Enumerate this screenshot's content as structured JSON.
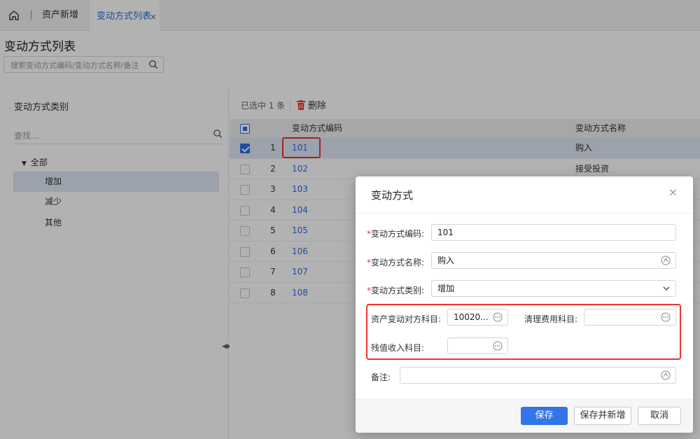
{
  "tabs": {
    "home_icon": "home-icon",
    "items": [
      {
        "label": "资产新增"
      },
      {
        "label": "变动方式列表",
        "close": "×"
      }
    ]
  },
  "page": {
    "title": "变动方式列表",
    "search_placeholder": "搜索变动方式编码/变动方式名称/备注"
  },
  "left_panel": {
    "title": "变动方式类别",
    "find_placeholder": "查找...",
    "tree_root": "全部",
    "tree_items": [
      "增加",
      "减少",
      "其他"
    ],
    "selected_item": "增加"
  },
  "toolbar": {
    "selected_count": "已选中 1 条",
    "delete_label": "删除"
  },
  "grid": {
    "columns": [
      "变动方式编码",
      "变动方式名称"
    ],
    "rows": [
      {
        "num": "1",
        "code": "101",
        "name": "购入",
        "checked": true
      },
      {
        "num": "2",
        "code": "102",
        "name": "接受投资",
        "checked": false
      },
      {
        "num": "3",
        "code": "103",
        "name": "",
        "checked": false
      },
      {
        "num": "4",
        "code": "104",
        "name": "",
        "checked": false
      },
      {
        "num": "5",
        "code": "105",
        "name": "",
        "checked": false
      },
      {
        "num": "6",
        "code": "106",
        "name": "",
        "checked": false
      },
      {
        "num": "7",
        "code": "107",
        "name": "",
        "checked": false
      },
      {
        "num": "8",
        "code": "108",
        "name": "",
        "checked": false
      }
    ]
  },
  "dialog": {
    "title": "变动方式",
    "close": "×",
    "fields": {
      "code_label": "变动方式编码:",
      "code_value": "101",
      "name_label": "变动方式名称:",
      "name_value": "购入",
      "type_label": "变动方式类别:",
      "type_value": "增加",
      "counter_label": "资产变动对方科目:",
      "counter_value": "10020...",
      "clean_label": "清理费用科目:",
      "clean_value": "",
      "residual_label": "残值收入科目:",
      "residual_value": "",
      "remark_label": "备注:",
      "remark_value": ""
    },
    "required_mark": "*",
    "buttons": {
      "save": "保存",
      "save_new": "保存并新增",
      "cancel": "取消"
    }
  },
  "colors": {
    "accent": "#3375e6",
    "link": "#2f6fe0",
    "highlight_box": "#ee3333",
    "selected_row": "#dfe8f7"
  }
}
